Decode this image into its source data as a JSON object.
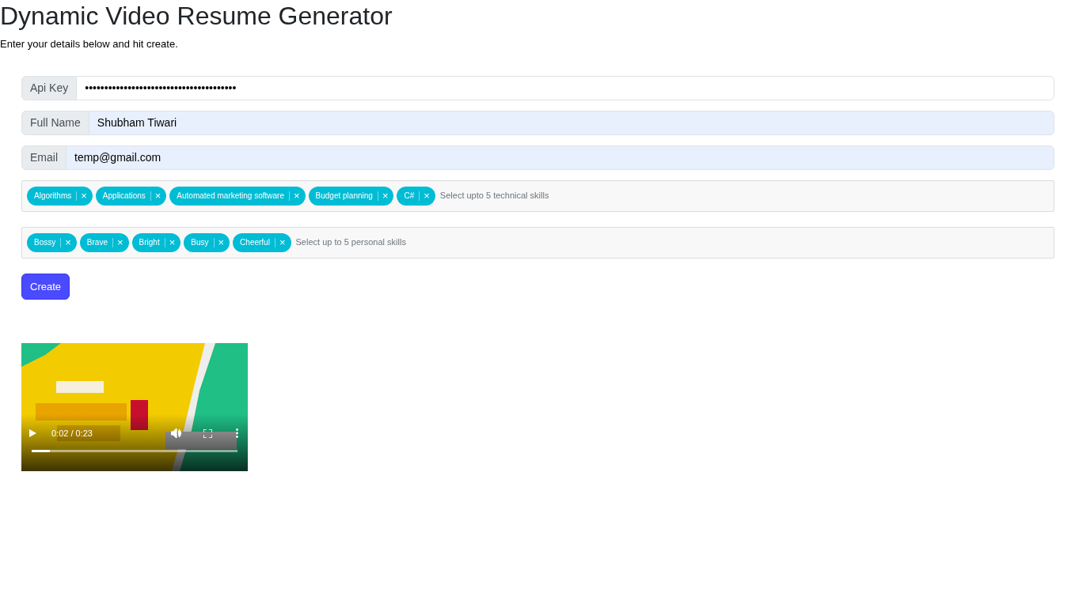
{
  "title": "Dynamic Video Resume Generator",
  "subtitle": "Enter your details below and hit create.",
  "fields": [
    {
      "label": "Api Key",
      "value": "•••••••••••••••••••••••••••••••••••••••",
      "autofilled": false
    },
    {
      "label": "Full Name",
      "value": "Shubham Tiwari",
      "autofilled": true
    },
    {
      "label": "Email",
      "value": "temp@gmail.com",
      "autofilled": true
    }
  ],
  "tag_inputs": [
    {
      "tags": [
        "Algorithms",
        "Applications",
        "Automated marketing software",
        "Budget planning",
        "C#"
      ],
      "remove_glyph": "×",
      "placeholder": "Select upto 5 technical skills"
    },
    {
      "tags": [
        "Bossy",
        "Brave",
        "Bright",
        "Busy",
        "Cheerful"
      ],
      "remove_glyph": "×",
      "placeholder": "Select up to 5 personal skills"
    }
  ],
  "create_button": "Create",
  "video": {
    "kind": "picture",
    "time": "0:02 / 0:23",
    "level": 0.09
  }
}
